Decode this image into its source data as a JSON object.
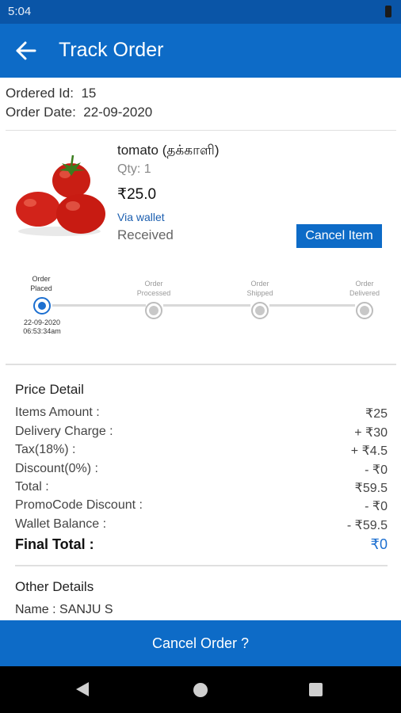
{
  "status_bar": {
    "time": "5:04"
  },
  "app_bar": {
    "title": "Track Order"
  },
  "order": {
    "id_label": "Ordered Id:",
    "id_value": "15",
    "date_label": "Order Date:",
    "date_value": "22-09-2020"
  },
  "item": {
    "name": "tomato (தக்காளி)",
    "qty": "Qty:  1",
    "price": "₹25.0",
    "payment": "Via wallet",
    "status": "Received",
    "cancel_button": "Cancel Item"
  },
  "tracking": {
    "steps": [
      {
        "label_line1": "Order",
        "label_line2": "Placed",
        "state": "done"
      },
      {
        "label_line1": "Order",
        "label_line2": "Processed",
        "state": "pending"
      },
      {
        "label_line1": "Order",
        "label_line2": "Shipped",
        "state": "pending"
      },
      {
        "label_line1": "Order",
        "label_line2": "Delivered",
        "state": "pending"
      }
    ],
    "placed_date": "22-09-2020",
    "placed_time": "06:53:34am"
  },
  "price_detail": {
    "title": "Price Detail",
    "rows": [
      {
        "label": "Items Amount :",
        "value": "₹25"
      },
      {
        "label": "Delivery Charge :",
        "value": "+ ₹30"
      },
      {
        "label": "Tax(18%) :",
        "value": "+ ₹4.5"
      },
      {
        "label": "Discount(0%) :",
        "value": "- ₹0"
      },
      {
        "label": "Total :",
        "value": "₹59.5"
      },
      {
        "label": "PromoCode Discount :",
        "value": "- ₹0"
      },
      {
        "label": "Wallet Balance :",
        "value": "- ₹59.5"
      }
    ],
    "final_label": "Final Total :",
    "final_value": "₹0"
  },
  "other_details": {
    "title": "Other Details",
    "name_line": "Name : SANJU S"
  },
  "bottom_button": "Cancel Order ?",
  "colors": {
    "primary": "#0d6bc7",
    "status_bar": "#0a55a7",
    "accent": "#1c6fd0"
  }
}
